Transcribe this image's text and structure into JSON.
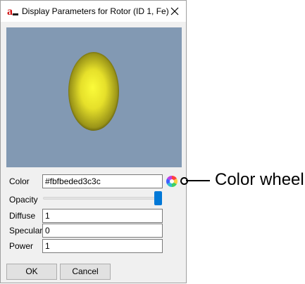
{
  "window": {
    "title": "Display Parameters for Rotor (ID 1, Fe)",
    "icon": "app-logo-icon",
    "close_icon": "close-icon"
  },
  "preview": {
    "background_color": "#8299b3",
    "object_color": "#fbfbed",
    "object_shade": "#3c3c00"
  },
  "fields": {
    "color_label": "Color",
    "color_value": "#fbfbeded3c3c",
    "opacity_label": "Opacity",
    "opacity_level": 1,
    "diffuse_label": "Diffuse",
    "diffuse_value": "1",
    "specular_label": "Specular",
    "specular_value": "0",
    "power_label": "Power",
    "power_value": "1"
  },
  "buttons": {
    "ok_label": "OK",
    "cancel_label": "Cancel"
  },
  "annotation": {
    "text": "Color wheel"
  },
  "colors": {
    "accent": "#0078d7",
    "dialog_bg": "#f0f0f0"
  }
}
